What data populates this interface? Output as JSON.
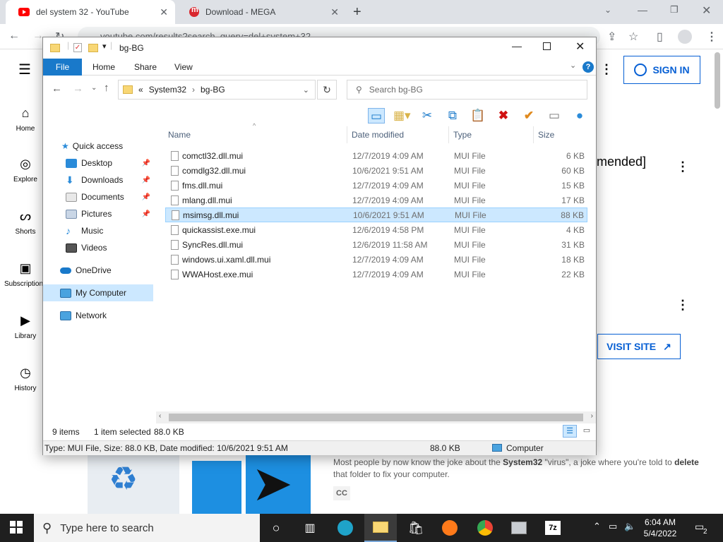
{
  "browser": {
    "tabs": [
      {
        "title": "del system 32 - YouTube",
        "active": true
      },
      {
        "title": "Download - MEGA",
        "active": false
      }
    ],
    "url": "youtube.com/results?search_query=del+system+32"
  },
  "youtube": {
    "nav": [
      {
        "label": "Home",
        "icon": "home-icon"
      },
      {
        "label": "Explore",
        "icon": "compass-icon"
      },
      {
        "label": "Shorts",
        "icon": "shorts-icon"
      },
      {
        "label": "Subscriptions",
        "icon": "subscriptions-icon"
      },
      {
        "label": "Library",
        "icon": "library-icon"
      },
      {
        "label": "History",
        "icon": "history-icon"
      }
    ],
    "sign_in_label": "SIGN IN",
    "partial_title": "mended]",
    "visit_site_label": "VISIT SITE",
    "description_pre": "Most people by now know the joke about the ",
    "description_bold1": "System32",
    "description_mid": " \"virus\", a joke where you're told to ",
    "description_bold2": "delete",
    "description_post": " that folder to fix your computer.",
    "cc_badge": "CC"
  },
  "explorer": {
    "title": "bg-BG",
    "ribbon_tabs": [
      "File",
      "Home",
      "Share",
      "View"
    ],
    "breadcrumb": {
      "prefix": "«",
      "parts": [
        "System32",
        "bg-BG"
      ]
    },
    "search_placeholder": "Search bg-BG",
    "nav": {
      "quick_access": "Quick access",
      "items": [
        {
          "label": "Desktop",
          "pinned": true
        },
        {
          "label": "Downloads",
          "pinned": true
        },
        {
          "label": "Documents",
          "pinned": true
        },
        {
          "label": "Pictures",
          "pinned": true
        },
        {
          "label": "Music",
          "pinned": false
        },
        {
          "label": "Videos",
          "pinned": false
        }
      ],
      "onedrive": "OneDrive",
      "computer": "My Computer",
      "network": "Network"
    },
    "columns": [
      "Name",
      "Date modified",
      "Type",
      "Size"
    ],
    "files": [
      {
        "name": "comctl32.dll.mui",
        "date": "12/7/2019 4:09 AM",
        "type": "MUI File",
        "size": "6 KB"
      },
      {
        "name": "comdlg32.dll.mui",
        "date": "10/6/2021 9:51 AM",
        "type": "MUI File",
        "size": "60 KB"
      },
      {
        "name": "fms.dll.mui",
        "date": "12/7/2019 4:09 AM",
        "type": "MUI File",
        "size": "15 KB"
      },
      {
        "name": "mlang.dll.mui",
        "date": "12/7/2019 4:09 AM",
        "type": "MUI File",
        "size": "17 KB"
      },
      {
        "name": "msimsg.dll.mui",
        "date": "10/6/2021 9:51 AM",
        "type": "MUI File",
        "size": "88 KB",
        "selected": true
      },
      {
        "name": "quickassist.exe.mui",
        "date": "12/6/2019 4:58 PM",
        "type": "MUI File",
        "size": "4 KB"
      },
      {
        "name": "SyncRes.dll.mui",
        "date": "12/6/2019 11:58 AM",
        "type": "MUI File",
        "size": "31 KB"
      },
      {
        "name": "windows.ui.xaml.dll.mui",
        "date": "12/7/2019 4:09 AM",
        "type": "MUI File",
        "size": "18 KB"
      },
      {
        "name": "WWAHost.exe.mui",
        "date": "12/7/2019 4:09 AM",
        "type": "MUI File",
        "size": "22 KB"
      }
    ],
    "status": {
      "count": "9 items",
      "selected": "1 item selected",
      "size": "88.0 KB"
    },
    "details": {
      "text": "Type: MUI File, Size: 88.0 KB, Date modified: 10/6/2021 9:51 AM",
      "size": "88.0 KB",
      "location": "Computer"
    }
  },
  "taskbar": {
    "search_placeholder": "Type here to search",
    "time": "6:04 AM",
    "date": "5/4/2022",
    "notifications": "2",
    "apps": [
      "task-view-icon",
      "edge-icon",
      "file-explorer-icon",
      "store-icon",
      "firefox-icon",
      "chrome-icon",
      "app-icon",
      "7zip-icon"
    ]
  },
  "colors": {
    "accent": "#1979ca",
    "youtube_blue": "#065fd4",
    "selection": "#cce8ff",
    "taskbar": "#1f1f1f"
  }
}
